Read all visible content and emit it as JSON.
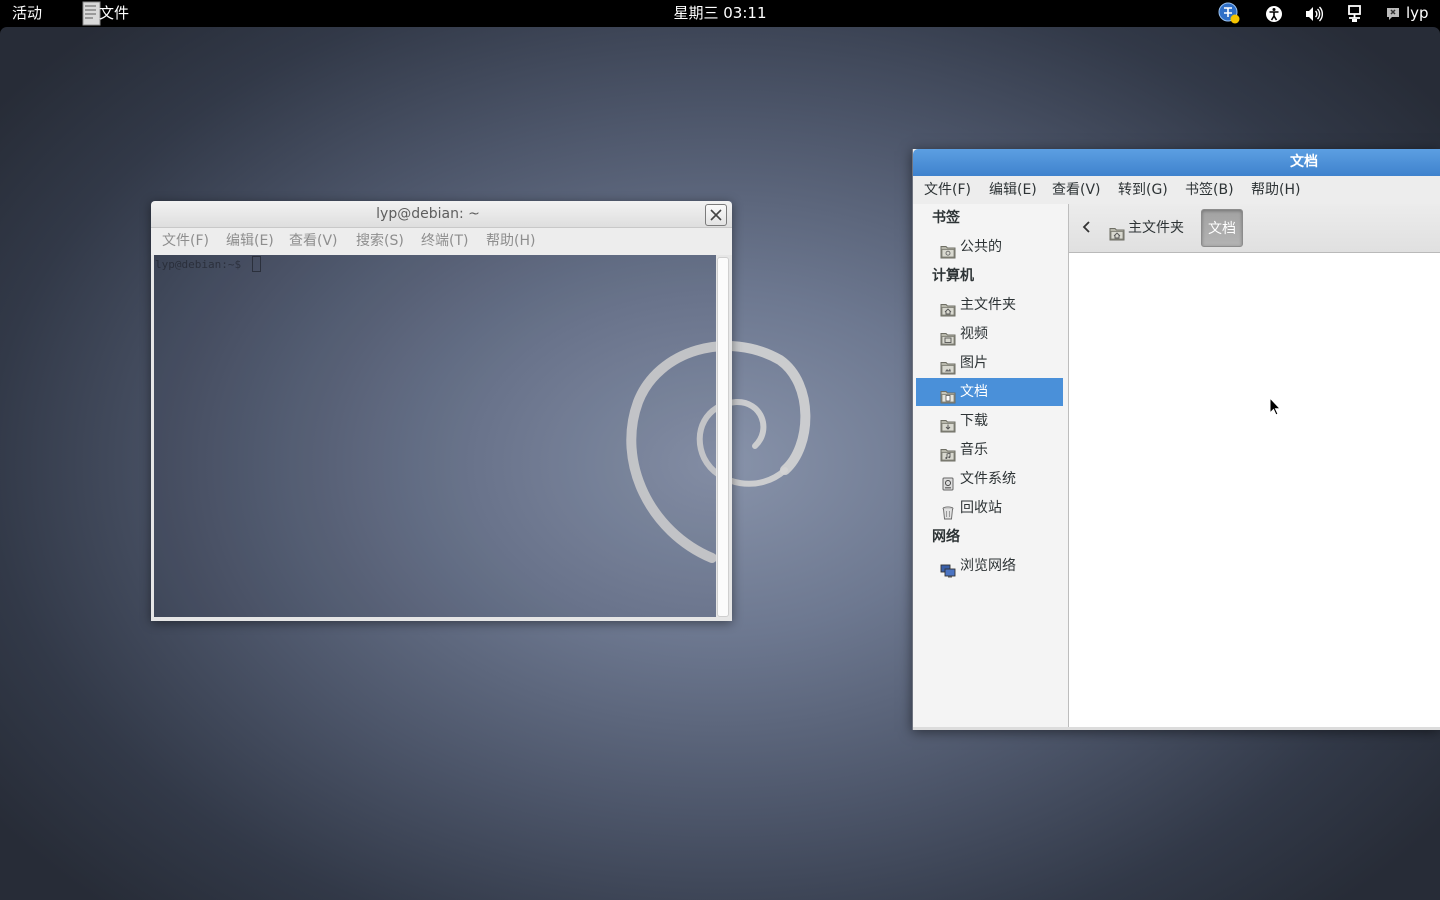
{
  "topbar": {
    "activities": "活动",
    "app_name": "文件",
    "clock": "星期三 03:11",
    "user": "lyp",
    "icons": [
      "app-files-icon",
      "ime-icon",
      "accessibility-icon",
      "volume-icon",
      "network-icon",
      "user-status-icon"
    ]
  },
  "terminal": {
    "title": "lyp@debian: ~",
    "menu": [
      "文件(F)",
      "编辑(E)",
      "查看(V)",
      "搜索(S)",
      "终端(T)",
      "帮助(H)"
    ],
    "prompt": "lyp@debian:~$"
  },
  "file_manager": {
    "title": "文档",
    "menu": [
      "文件(F)",
      "编辑(E)",
      "查看(V)",
      "转到(G)",
      "书签(B)",
      "帮助(H)"
    ],
    "sidebar": {
      "bookmarks_header": "书签",
      "bookmarks": [
        {
          "label": "公共的",
          "icon": "public-folder-icon"
        }
      ],
      "computer_header": "计算机",
      "computer": [
        {
          "label": "主文件夹",
          "icon": "home-folder-icon"
        },
        {
          "label": "视频",
          "icon": "videos-folder-icon"
        },
        {
          "label": "图片",
          "icon": "pictures-folder-icon"
        },
        {
          "label": "文档",
          "icon": "documents-folder-icon",
          "selected": true
        },
        {
          "label": "下载",
          "icon": "downloads-folder-icon"
        },
        {
          "label": "音乐",
          "icon": "music-folder-icon"
        },
        {
          "label": "文件系统",
          "icon": "filesystem-icon"
        },
        {
          "label": "回收站",
          "icon": "trash-icon"
        }
      ],
      "network_header": "网络",
      "network": [
        {
          "label": "浏览网络",
          "icon": "network-browse-icon"
        }
      ]
    },
    "pathbar": {
      "home": "主文件夹",
      "current": "文档"
    }
  },
  "colors": {
    "accent": "#4a90d9",
    "titlebar_active": "#4a8fd6",
    "topbar": "#000000"
  }
}
